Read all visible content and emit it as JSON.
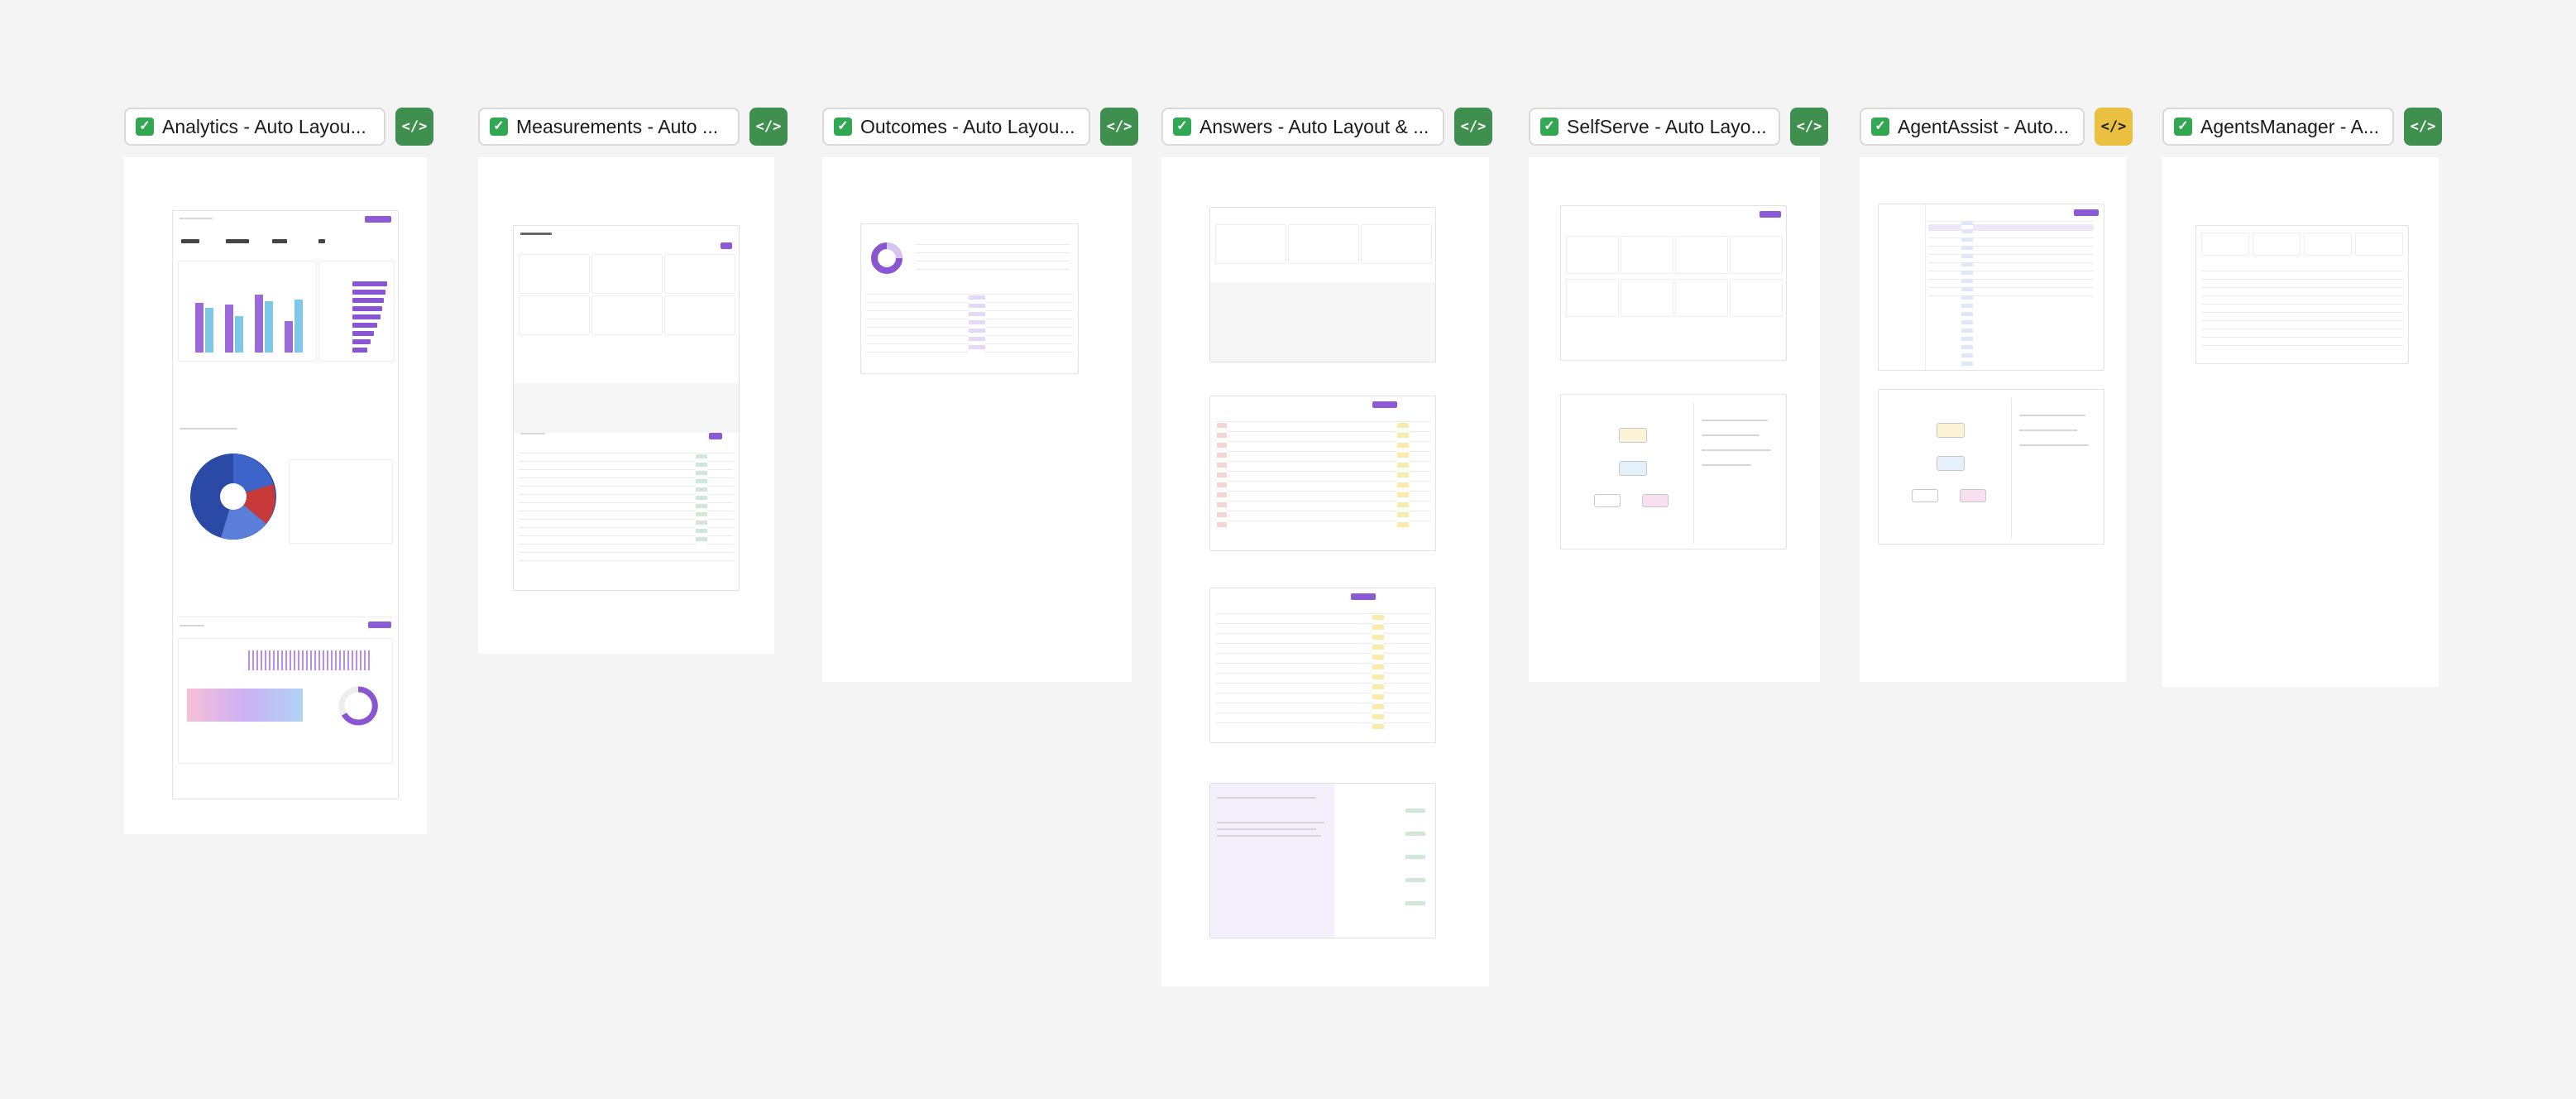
{
  "sections": [
    {
      "name": "Analytics - Auto Layout",
      "title": "Analytics - Auto Layou...",
      "status": "done",
      "dev_icon": "code-icon",
      "dev_color": "green"
    },
    {
      "name": "Measurements - Auto",
      "title": "Measurements - Auto ...",
      "status": "done",
      "dev_icon": "code-icon",
      "dev_color": "green"
    },
    {
      "name": "Outcomes - Auto Layout",
      "title": "Outcomes - Auto Layou...",
      "status": "done",
      "dev_icon": "code-icon",
      "dev_color": "green"
    },
    {
      "name": "Answers - Auto Layout &",
      "title": "Answers - Auto Layout & ...",
      "status": "done",
      "dev_icon": "code-icon",
      "dev_color": "green"
    },
    {
      "name": "SelfServe - Auto Layout",
      "title": "SelfServe - Auto Layo...",
      "status": "done",
      "dev_icon": "code-icon",
      "dev_color": "green"
    },
    {
      "name": "AgentAssist - Auto",
      "title": "AgentAssist - Auto...",
      "status": "done",
      "dev_icon": "code-icon",
      "dev_color": "yellow"
    },
    {
      "name": "AgentsManager - A",
      "title": "AgentsManager - A...",
      "status": "done",
      "dev_icon": "code-icon",
      "dev_color": "green"
    }
  ],
  "glyphs": {
    "check": "✓",
    "code": "</>"
  },
  "colors": {
    "canvas": "#f4f4f4",
    "status_done": "#33a852",
    "dev_green": "#3f8f4f",
    "dev_yellow": "#e9c040",
    "accent_purple": "#8c5ad6",
    "accent_blue": "#7ec7e6"
  }
}
